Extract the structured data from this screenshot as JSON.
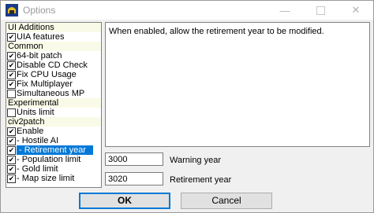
{
  "window": {
    "title": "Options",
    "app_icon": "civ-helmet-icon",
    "controls": {
      "minimize": "minimize-icon",
      "maximize": "maximize-icon",
      "close": "close-icon"
    }
  },
  "sidebar": {
    "rows": [
      {
        "type": "section",
        "label": "UI Additions"
      },
      {
        "type": "option",
        "label": "UIA features",
        "checked": true
      },
      {
        "type": "section",
        "label": "Common"
      },
      {
        "type": "option",
        "label": "64-bit patch",
        "checked": true
      },
      {
        "type": "option",
        "label": "Disable CD Check",
        "checked": true
      },
      {
        "type": "option",
        "label": "Fix CPU Usage",
        "checked": true
      },
      {
        "type": "option",
        "label": "Fix Multiplayer",
        "checked": true
      },
      {
        "type": "option",
        "label": "Simultaneous MP",
        "checked": false
      },
      {
        "type": "section",
        "label": "Experimental"
      },
      {
        "type": "option",
        "label": "Units limit",
        "checked": false
      },
      {
        "type": "section",
        "label": "civ2patch"
      },
      {
        "type": "option",
        "label": "Enable",
        "checked": true
      },
      {
        "type": "option",
        "label": "-   Hostile AI",
        "checked": true
      },
      {
        "type": "option",
        "label": "-   Retirement year",
        "checked": true,
        "selected": true
      },
      {
        "type": "option",
        "label": "-   Population limit",
        "checked": true
      },
      {
        "type": "option",
        "label": "-   Gold limit",
        "checked": true
      },
      {
        "type": "option",
        "label": "-   Map size limit",
        "checked": true
      }
    ]
  },
  "description": "When enabled, allow the retirement year to be modified.",
  "fields": {
    "warning_year": {
      "value": "3000",
      "label": "Warning year"
    },
    "retirement_year": {
      "value": "3020",
      "label": "Retirement year"
    }
  },
  "buttons": {
    "ok": "OK",
    "cancel": "Cancel"
  },
  "colors": {
    "selection": "#0078d7",
    "section_bg": "#fafae8"
  }
}
